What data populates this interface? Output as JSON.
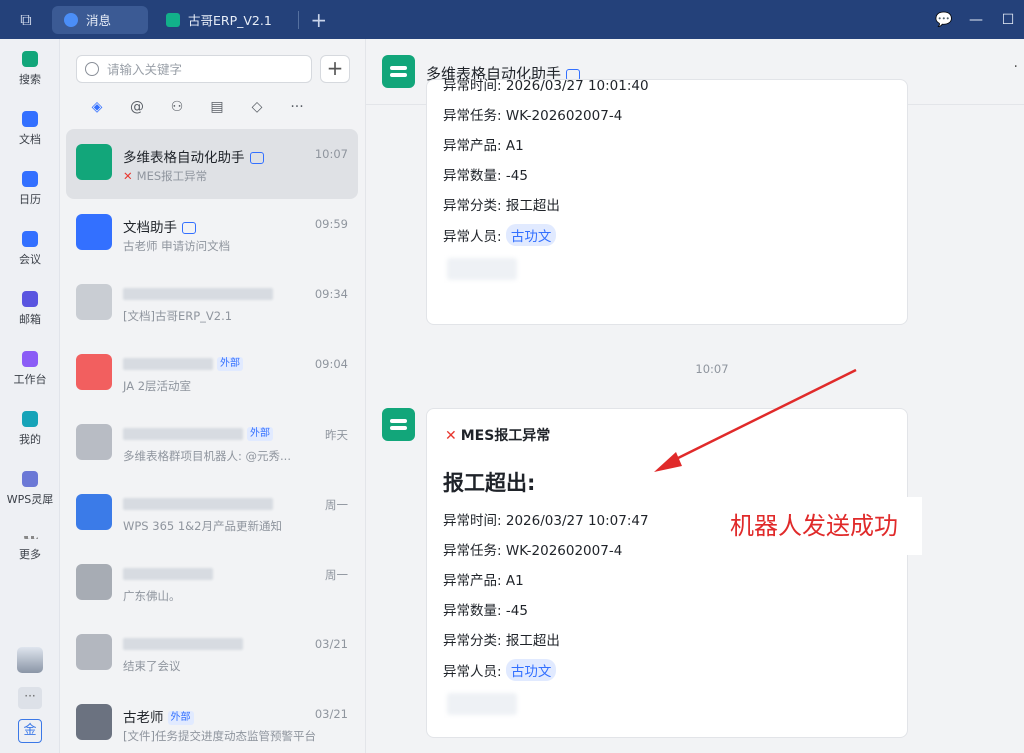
{
  "titlebar": {
    "tabs": [
      {
        "label": "消息",
        "active": true
      },
      {
        "label": "古哥ERP_V2.1",
        "active": false
      }
    ]
  },
  "leftnav": {
    "items": [
      {
        "label": "搜索",
        "color": "#12a67a"
      },
      {
        "label": "文档",
        "color": "#3370ff"
      },
      {
        "label": "日历",
        "color": "#3370ff"
      },
      {
        "label": "会议",
        "color": "#3370ff"
      },
      {
        "label": "邮箱",
        "color": "#5a55e0"
      },
      {
        "label": "工作台",
        "color": "#8b5cf6"
      },
      {
        "label": "我的",
        "color": "#16a3b8"
      },
      {
        "label": "WPS灵犀",
        "color": "#6b78d6"
      },
      {
        "label": "更多",
        "color": "#888888"
      }
    ],
    "bottom_label": "金"
  },
  "search": {
    "placeholder": "请输入关键字"
  },
  "conversations": [
    {
      "name": "多维表格自动化助手",
      "sub": "MES报工异常",
      "time": "10:07",
      "active": true
    },
    {
      "name": "文档助手",
      "sub": "古老师 申请访问文档",
      "time": "09:59"
    },
    {
      "name": "",
      "sub": "[文档]古哥ERP_V2.1",
      "time": "09:34"
    },
    {
      "name": "",
      "sub": "JA 2层活动室",
      "time": "09:04",
      "tag": "外部"
    },
    {
      "name": "",
      "sub": "多维表格群项目机器人: @元秀...",
      "time": "昨天",
      "tag": "外部"
    },
    {
      "name": "",
      "sub": "WPS 365 1&2月产品更新通知",
      "time": "周一"
    },
    {
      "name": "",
      "sub": "广东佛山。",
      "time": "周一"
    },
    {
      "name": "",
      "sub": "结束了会议",
      "time": "03/21"
    },
    {
      "name": "古老师",
      "sub": "[文件]任务提交进度动态监管预警平台",
      "time": "03/21",
      "tag": "外部"
    }
  ],
  "chat": {
    "title": "多维表格自动化助手",
    "divider_time": "10:07",
    "card1": {
      "fields": [
        {
          "label": "异常时间:",
          "value": "2026/03/27 10:01:40"
        },
        {
          "label": "异常任务:",
          "value": "WK-202602007-4"
        },
        {
          "label": "异常产品:",
          "value": "A1"
        },
        {
          "label": "异常数量:",
          "value": "-45"
        },
        {
          "label": "异常分类:",
          "value": "报工超出"
        },
        {
          "label": "异常人员:",
          "value": "古功文"
        }
      ]
    },
    "card2": {
      "head": "MES报工异常",
      "title": "报工超出:",
      "fields": [
        {
          "label": "异常时间:",
          "value": "2026/03/27 10:07:47"
        },
        {
          "label": "异常任务:",
          "value": "WK-202602007-4"
        },
        {
          "label": "异常产品:",
          "value": "A1"
        },
        {
          "label": "异常数量:",
          "value": "-45"
        },
        {
          "label": "异常分类:",
          "value": "报工超出"
        },
        {
          "label": "异常人员:",
          "value": "古功文"
        }
      ]
    },
    "annotation": "机器人发送成功"
  }
}
